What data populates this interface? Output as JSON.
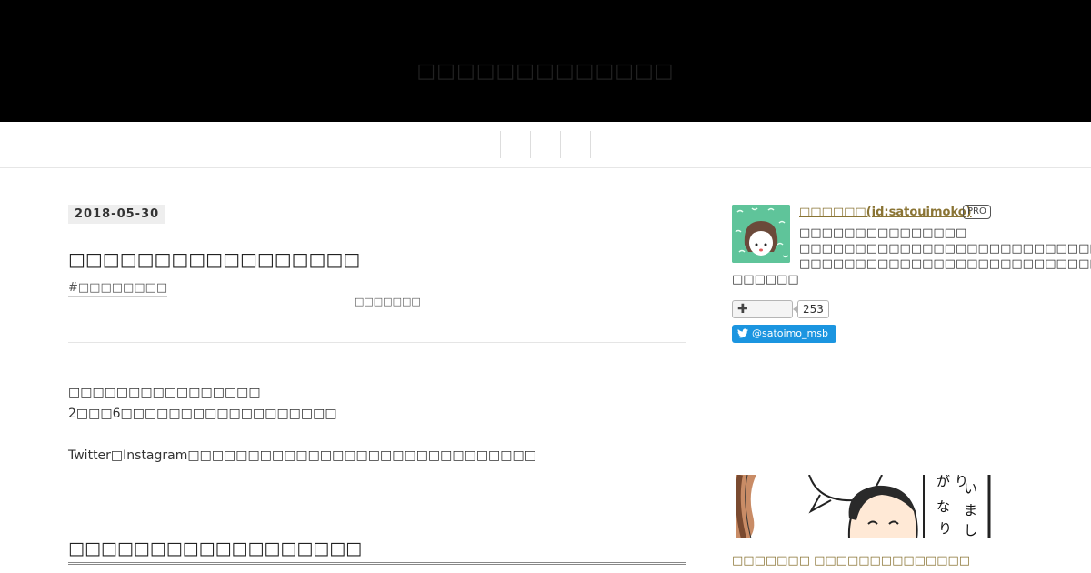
{
  "header": {
    "blog_title": "□□□□□□□□□□□□□"
  },
  "globalnav": {
    "items": [
      "",
      "",
      ""
    ]
  },
  "entry": {
    "date": "2018-05-30",
    "title": "□□□□□□□□□□□□□□□□□",
    "category": "#□□□□□□□□",
    "sub_label": "□□□□□□□",
    "paragraphs": [
      "□□□□□□□□□□□□□□□□",
      "2□□□6□□□□□□□□□□□□□□□□□□",
      "Twitter□Instagram□□□□□□□□□□□□□□□□□□□□□□□□□□□□□"
    ],
    "heading": "□□□□□□□□□□□□□□□□□□"
  },
  "sidebar": {
    "profile": {
      "name": "□□□□□□(id:satouimoko)",
      "badge": "PRO",
      "description_lines": [
        "□□□□□□□□□□□□□□□",
        "□□□□□□□□□□□□□□□□□□□□□□□□□□□",
        "□□□□□□□□□□□□□□□□□□□□□□□□□□□□□□",
        "□□□□□□"
      ]
    },
    "subscribe": {
      "icon": "plus-icon",
      "count": "253"
    },
    "twitter": {
      "icon": "twitter-bird-icon",
      "handle": "@satoimo_msb",
      "color": "#1b95e0"
    },
    "manga": {
      "caption": "□□□□□□□ □□□□□□□□□□□□□□"
    }
  },
  "colors": {
    "header_bg": "#000000",
    "link": "#8a7434",
    "avatar_bg": "#5fc49a"
  }
}
